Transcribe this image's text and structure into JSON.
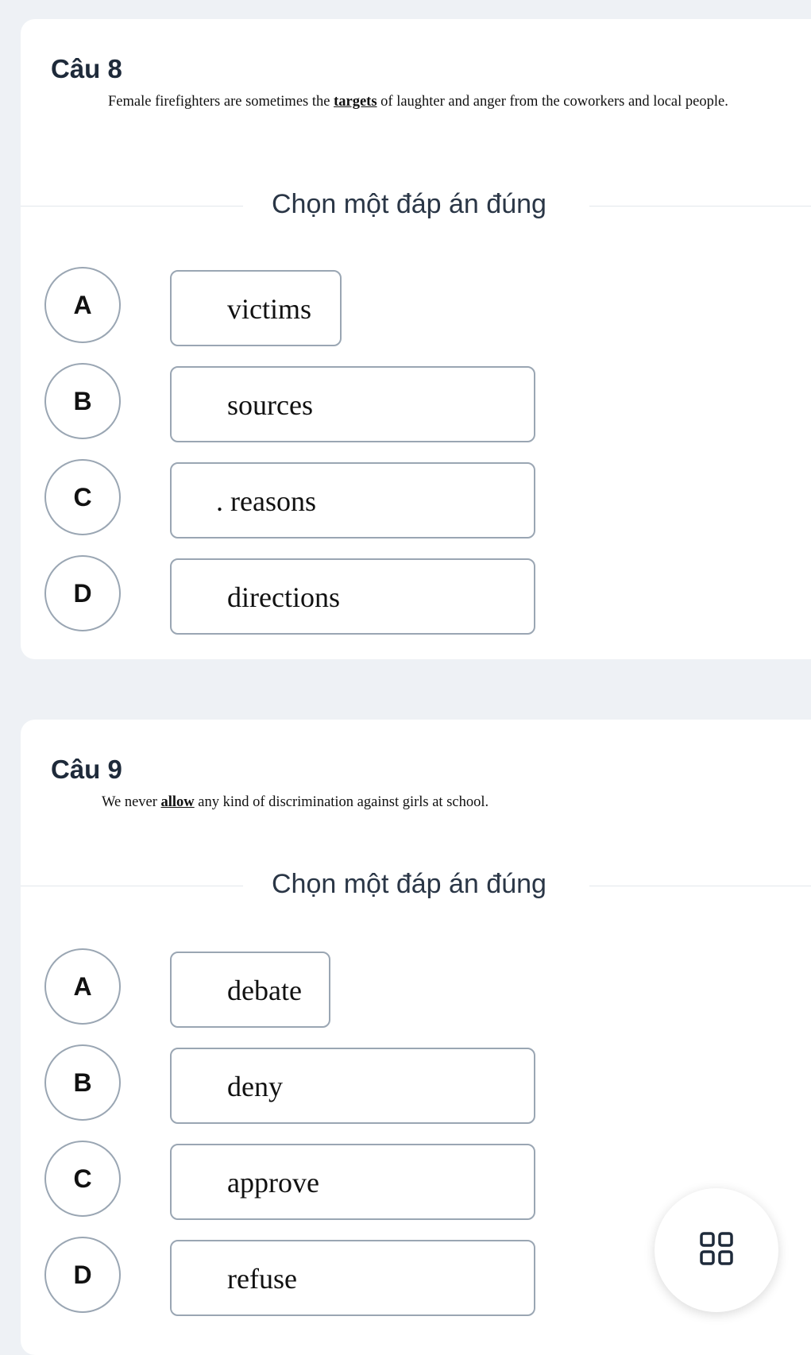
{
  "questions": [
    {
      "title": "Câu 8",
      "text_before": "Female firefighters are sometimes the ",
      "underlined": "targets",
      "text_after": " of laughter and anger from the coworkers and local people.",
      "instruction": "Chọn một đáp án đúng",
      "options": [
        {
          "letter": "A",
          "text": "victims"
        },
        {
          "letter": "B",
          "text": "sources"
        },
        {
          "letter": "C",
          "text": ". reasons"
        },
        {
          "letter": "D",
          "text": "directions"
        }
      ]
    },
    {
      "title": "Câu 9",
      "text_before": "We never ",
      "underlined": "allow",
      "text_after": " any kind of discrimination against girls at school.",
      "instruction": "Chọn một đáp án đúng",
      "options": [
        {
          "letter": "A",
          "text": "debate"
        },
        {
          "letter": "B",
          "text": "deny"
        },
        {
          "letter": "C",
          "text": "approve"
        },
        {
          "letter": "D",
          "text": "refuse"
        }
      ]
    }
  ],
  "fab_icon": "grid-menu-icon"
}
